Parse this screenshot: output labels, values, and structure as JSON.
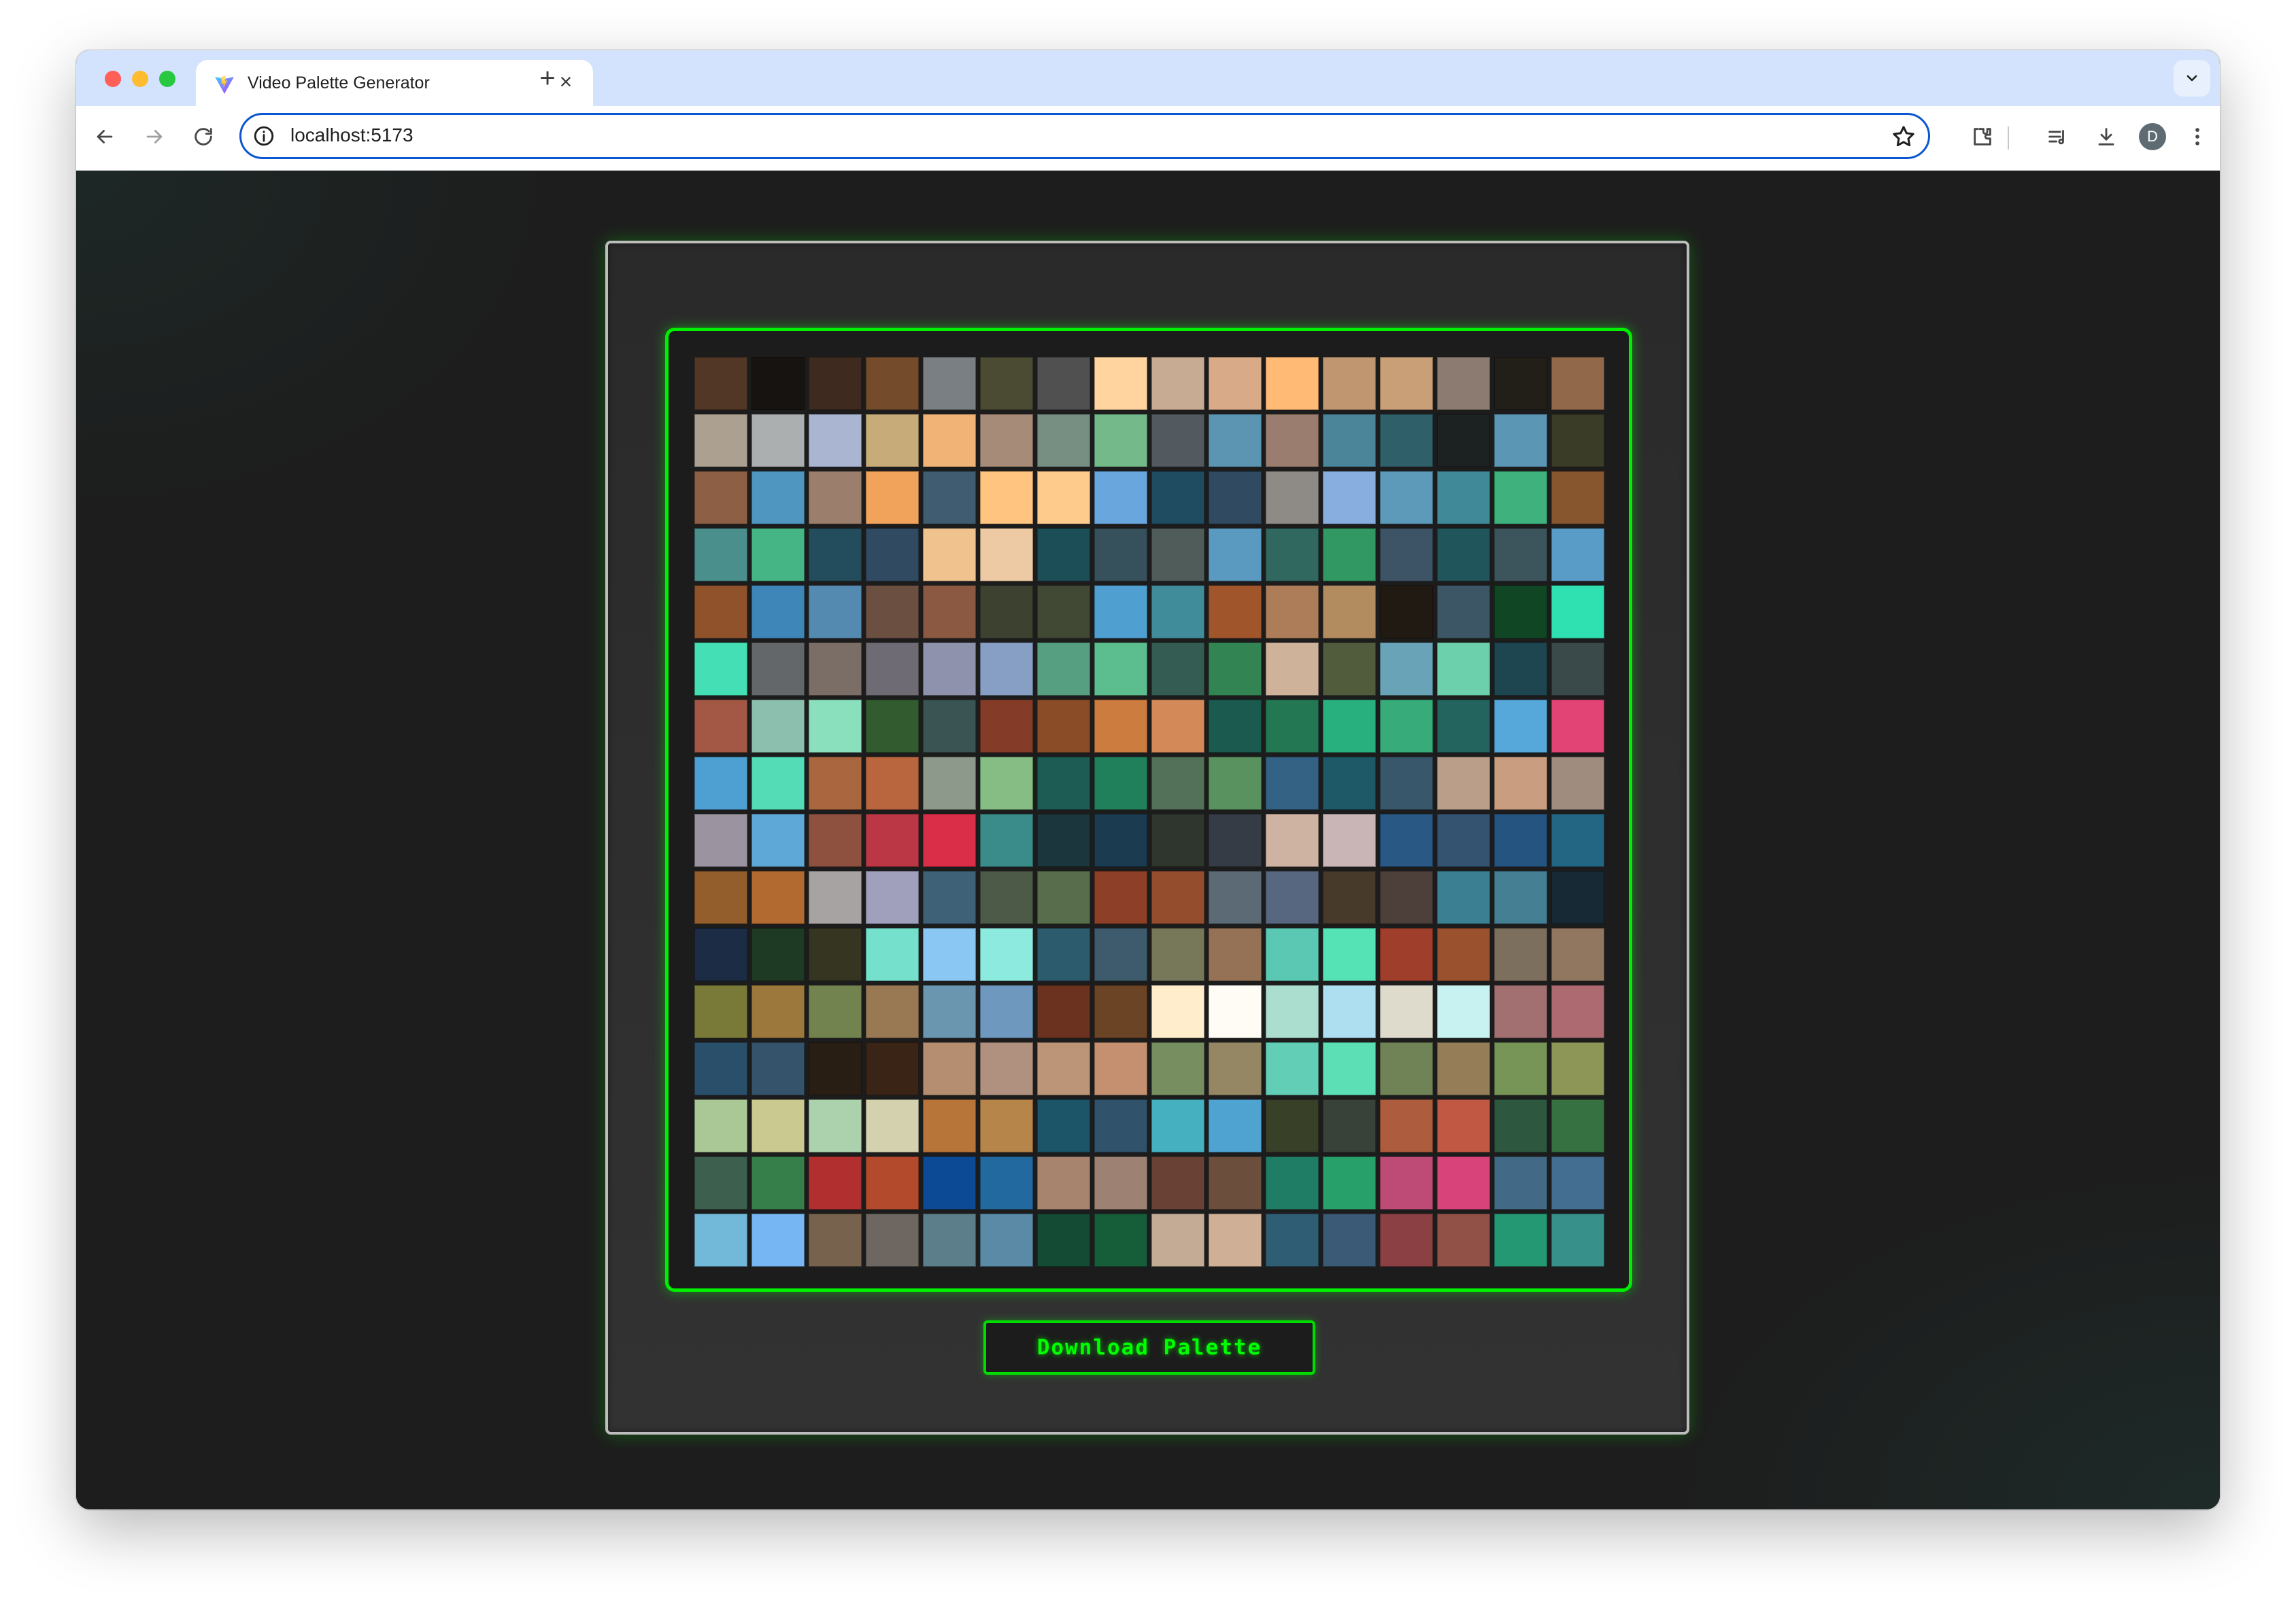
{
  "browser": {
    "tab_title": "Video Palette Generator",
    "url": "localhost:5173",
    "profile_initial": "D"
  },
  "app": {
    "download_label": "Download Palette",
    "accent_color": "#00ff00",
    "palette": [
      [
        "#523726",
        "#161310",
        "#3e2a1f",
        "#744c2b",
        "#7a7f83",
        "#4b4a33",
        "#515051",
        "#ffd49e",
        "#c7ab92",
        "#d9aa88",
        "#ffba76",
        "#c09670",
        "#c99f78",
        "#8b7b70",
        "#221f19",
        "#91694a"
      ],
      [
        "#aca091",
        "#acafb0",
        "#a9b5d1",
        "#c7ac7a",
        "#f1b376",
        "#a68c78",
        "#778f83",
        "#74b98a",
        "#52595f",
        "#5c95b1",
        "#9b7d6f",
        "#4a8599",
        "#2f5f68",
        "#1c2121",
        "#5b96b5",
        "#3a3c28"
      ],
      [
        "#8d6046",
        "#4f97c0",
        "#9c7e6d",
        "#f1a35b",
        "#405c71",
        "#ffc47f",
        "#ffcb8d",
        "#6aa6de",
        "#1f4c60",
        "#2f4a61",
        "#8e8b86",
        "#88addf",
        "#5d99b9",
        "#408998",
        "#3fb17c",
        "#87562f"
      ],
      [
        "#4a8f8c",
        "#46b586",
        "#234d5d",
        "#304a62",
        "#f0c38e",
        "#eecaa4",
        "#1b4e57",
        "#36505c",
        "#505c59",
        "#5a9ac1",
        "#30675f",
        "#319763",
        "#3d5366",
        "#1f555b",
        "#3c555c",
        "#5a9cc8"
      ],
      [
        "#8f522a",
        "#3d86b7",
        "#558ab0",
        "#6b4f41",
        "#8b5842",
        "#3d4130",
        "#414833",
        "#4fa0d0",
        "#408c9a",
        "#a0552b",
        "#ad7c58",
        "#b28c5e",
        "#211a13",
        "#3c5665",
        "#104624",
        "#2fe0b1"
      ],
      [
        "#44dfb4",
        "#636769",
        "#7b6e67",
        "#6f6b74",
        "#8f92ac",
        "#879fc4",
        "#569f81",
        "#5cbd8e",
        "#355c53",
        "#338453",
        "#cfb29a",
        "#505c3b",
        "#69a3b7",
        "#6dd0ac",
        "#1e4650",
        "#3a4a4a"
      ],
      [
        "#a35845",
        "#8cbfad",
        "#8adfbc",
        "#325b30",
        "#3a5353",
        "#843c28",
        "#8a4c26",
        "#cd7c3f",
        "#d38a58",
        "#1b5a4e",
        "#237752",
        "#28b17e",
        "#37ab7a",
        "#23645e",
        "#56a7da",
        "#e14475"
      ],
      [
        "#4ea0d2",
        "#53dcb6",
        "#a9663f",
        "#b9663f",
        "#8d998a",
        "#86bd84",
        "#1d5c55",
        "#1f805b",
        "#527158",
        "#59915f",
        "#336285",
        "#1d5966",
        "#38576a",
        "#bb9e8a",
        "#c89d80",
        "#a08c7e"
      ],
      [
        "#9b94a0",
        "#5ea8d8",
        "#8e5140",
        "#bb3746",
        "#da2d48",
        "#3a8c8b",
        "#1b363d",
        "#1b3b51",
        "#2f362e",
        "#353c45",
        "#cfb3a2",
        "#c9b4b6",
        "#295885",
        "#335370",
        "#255480",
        "#226684"
      ],
      [
        "#935d2c",
        "#b26a31",
        "#a8a3a3",
        "#a1a0bc",
        "#3e6178",
        "#4e5a48",
        "#586d4b",
        "#8d4027",
        "#944e2d",
        "#5b6a74",
        "#56677f",
        "#473a2a",
        "#4d403b",
        "#3a8092",
        "#447f94",
        "#172934"
      ],
      [
        "#1b2c44",
        "#1f3a24",
        "#353522",
        "#75e0cb",
        "#8bc7f3",
        "#8deadf",
        "#2d5b6e",
        "#3e5b6e",
        "#777759",
        "#957256",
        "#5bc8b3",
        "#55e2b5",
        "#9f3e2a",
        "#9a512d",
        "#7d6f5e",
        "#917660"
      ],
      [
        "#797938",
        "#9c783d",
        "#738350",
        "#987954",
        "#6a96b0",
        "#6f98bf",
        "#6b3220",
        "#6b4325",
        "#ffedcb",
        "#fffcf5",
        "#abdecf",
        "#addff0",
        "#dfdbcc",
        "#c8f2f2",
        "#a27070",
        "#ad6a70"
      ],
      [
        "#2a4f6b",
        "#35546b",
        "#281e13",
        "#3a2416",
        "#b58e71",
        "#b0907e",
        "#bc9477",
        "#c49070",
        "#778e60",
        "#968764",
        "#63ceb6",
        "#5ddfb5",
        "#708356",
        "#947d57",
        "#769556",
        "#8d9656"
      ],
      [
        "#aac895",
        "#c9c990",
        "#abd2ad",
        "#d3d1ae",
        "#b7753a",
        "#b5854a",
        "#1b5567",
        "#30526a",
        "#44b0c0",
        "#4fa3d1",
        "#394028",
        "#394238",
        "#ad5c3d",
        "#c15843",
        "#2e5740",
        "#367141"
      ],
      [
        "#3c5f4e",
        "#367f4a",
        "#b22f2f",
        "#b34a2c",
        "#0c4a95",
        "#2269a0",
        "#a6846d",
        "#9d8173",
        "#6a4235",
        "#6b4e3b",
        "#207d65",
        "#27a06a",
        "#be4b76",
        "#d84479",
        "#426985",
        "#446d92"
      ],
      [
        "#71b8d9",
        "#75b6f3",
        "#77624d",
        "#6d6661",
        "#5b7e8a",
        "#5a8aa6",
        "#134b35",
        "#165e3a",
        "#c3ab95",
        "#cfb096",
        "#2f5d73",
        "#3a5a75",
        "#8b4044",
        "#915146",
        "#249773",
        "#379089"
      ]
    ]
  },
  "icons": {
    "favicon": "vite-logo-icon",
    "back": "arrow-left-icon",
    "forward": "arrow-right-icon",
    "reload": "reload-icon",
    "info": "info-icon",
    "star": "star-icon",
    "extensions": "puzzle-icon",
    "media": "media-queue-icon",
    "download": "download-icon",
    "menu": "kebab-menu-icon",
    "tab_search": "chevron-down-icon"
  }
}
